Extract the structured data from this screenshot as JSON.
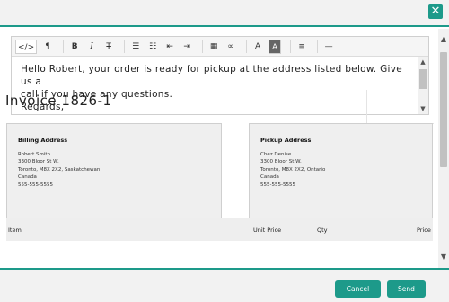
{
  "header": {
    "close_icon": "close-icon",
    "accent": "#1d9a8a"
  },
  "toolbar": {
    "code": "</>",
    "paragraph": "¶",
    "bold": "B",
    "italic": "I",
    "strike": "T",
    "ul": "☰",
    "ol": "☷",
    "outdent": "⇤",
    "indent": "⇥",
    "table": "▦",
    "link": "∞",
    "font_color": "A",
    "bg_color": "A",
    "align": "≡",
    "hr": "—"
  },
  "editor": {
    "line1": "Hello Robert, your order is ready for pickup at the address listed below. Give us a",
    "line2": "call if you have any questions.",
    "line3": "Regards,"
  },
  "invoice": {
    "title": "Invoice 1826-1",
    "billing": {
      "heading": "Billing Address",
      "lines": [
        "Robert Smith",
        "3300 Bloor St W.",
        "Toronto, M8X 2X2, Saskatchewan",
        "Canada",
        "555-555-5555"
      ]
    },
    "pickup": {
      "heading": "Pickup Address",
      "lines": [
        "Chez Denise",
        "3300 Bloor St W.",
        "Toronto, M8X 2X2, Ontario",
        "Canada",
        "555-555-5555"
      ]
    },
    "table": {
      "item": "Item",
      "unit_price": "Unit Price",
      "qty": "Qty",
      "price": "Price"
    }
  },
  "footer": {
    "cancel_label": "Cancel",
    "send_label": "Send"
  }
}
